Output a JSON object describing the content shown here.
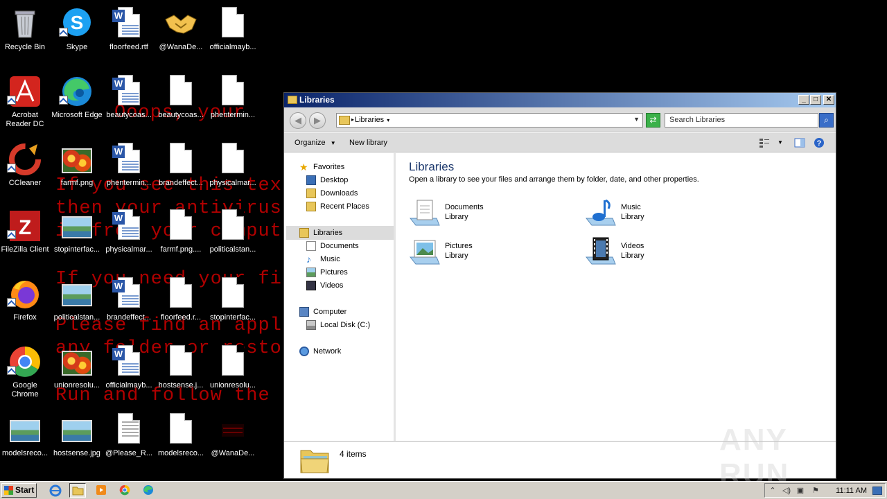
{
  "wallpaper": {
    "lines": [
      "Ooops, your",
      "If you see this tex",
      "then your antivirus",
      "is free your comput",
      "If you need your fi",
      "Please find an appl",
      "any folder or resto",
      "Run and follow the"
    ],
    "color": "#b00000"
  },
  "desktop": {
    "icons": [
      {
        "label": "Recycle Bin",
        "icon": "recycle-bin-icon"
      },
      {
        "label": "Skype",
        "icon": "skype-icon"
      },
      {
        "label": "floorfeed.rtf",
        "icon": "word-document-icon"
      },
      {
        "label": "@WanaDe...",
        "icon": "handshake-icon"
      },
      {
        "label": "officialmayb...",
        "icon": "blank-file-icon"
      },
      {
        "label": "Acrobat Reader DC",
        "icon": "acrobat-icon"
      },
      {
        "label": "Microsoft Edge",
        "icon": "edge-icon"
      },
      {
        "label": "beautycoas...",
        "icon": "word-document-icon"
      },
      {
        "label": "beautycoas...",
        "icon": "blank-file-icon"
      },
      {
        "label": "phentermin...",
        "icon": "blank-file-icon"
      },
      {
        "label": "CCleaner",
        "icon": "ccleaner-icon"
      },
      {
        "label": "farmf.png",
        "icon": "flower-image-icon"
      },
      {
        "label": "phentermin...",
        "icon": "word-document-icon"
      },
      {
        "label": "brandeffect...",
        "icon": "blank-file-icon"
      },
      {
        "label": "physicalmar...",
        "icon": "blank-file-icon"
      },
      {
        "label": "FileZilla Client",
        "icon": "filezilla-icon"
      },
      {
        "label": "stopinterfac...",
        "icon": "landscape-image-icon"
      },
      {
        "label": "physicalmar...",
        "icon": "word-document-icon"
      },
      {
        "label": "farmf.png....",
        "icon": "blank-file-icon"
      },
      {
        "label": "politicalstan...",
        "icon": "blank-file-icon"
      },
      {
        "label": "Firefox",
        "icon": "firefox-icon"
      },
      {
        "label": "politicalstan...",
        "icon": "landscape-image-icon"
      },
      {
        "label": "brandeffect...",
        "icon": "word-document-icon"
      },
      {
        "label": "floorfeed.r...",
        "icon": "blank-file-icon"
      },
      {
        "label": "stopinterfac...",
        "icon": "blank-file-icon"
      },
      {
        "label": "Google Chrome",
        "icon": "chrome-icon"
      },
      {
        "label": "unionresolu...",
        "icon": "flower-image-icon"
      },
      {
        "label": "officialmayb...",
        "icon": "word-document-icon"
      },
      {
        "label": "hostsense.j...",
        "icon": "blank-file-icon"
      },
      {
        "label": "unionresolu...",
        "icon": "blank-file-icon"
      },
      {
        "label": "modelsreco...",
        "icon": "landscape-image-icon"
      },
      {
        "label": "hostsense.jpg",
        "icon": "landscape-image-icon"
      },
      {
        "label": "@Please_R...",
        "icon": "text-file-icon"
      },
      {
        "label": "modelsreco...",
        "icon": "blank-file-icon"
      },
      {
        "label": "@WanaDe...",
        "icon": "wanadecryptor-icon"
      }
    ]
  },
  "window": {
    "title": "Libraries",
    "address": "Libraries",
    "search_placeholder": "Search Libraries",
    "toolbar": {
      "organize": "Organize",
      "new_library": "New library"
    },
    "nav": {
      "favorites": "Favorites",
      "desktop": "Desktop",
      "downloads": "Downloads",
      "recent_places": "Recent Places",
      "libraries": "Libraries",
      "documents": "Documents",
      "music": "Music",
      "pictures": "Pictures",
      "videos": "Videos",
      "computer": "Computer",
      "local_disk": "Local Disk (C:)",
      "network": "Network"
    },
    "content": {
      "heading": "Libraries",
      "description": "Open a library to see your files and arrange them by folder, date, and other properties.",
      "libraries": [
        {
          "name": "Documents",
          "type": "Library",
          "icon": "documents-library-icon"
        },
        {
          "name": "Music",
          "type": "Library",
          "icon": "music-library-icon"
        },
        {
          "name": "Pictures",
          "type": "Library",
          "icon": "pictures-library-icon"
        },
        {
          "name": "Videos",
          "type": "Library",
          "icon": "videos-library-icon"
        }
      ]
    },
    "details": {
      "count": "4 items"
    }
  },
  "taskbar": {
    "start": "Start",
    "clock": "11:11 AM"
  },
  "watermark": "ANY RUN"
}
